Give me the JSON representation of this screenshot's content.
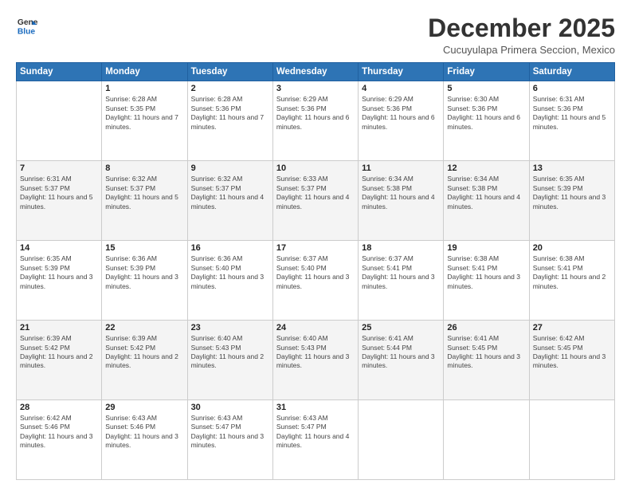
{
  "header": {
    "logo_line1": "General",
    "logo_line2": "Blue",
    "month": "December 2025",
    "location": "Cucuyulapa Primera Seccion, Mexico"
  },
  "weekdays": [
    "Sunday",
    "Monday",
    "Tuesday",
    "Wednesday",
    "Thursday",
    "Friday",
    "Saturday"
  ],
  "weeks": [
    [
      {
        "day": "",
        "sunrise": "",
        "sunset": "",
        "daylight": ""
      },
      {
        "day": "1",
        "sunrise": "Sunrise: 6:28 AM",
        "sunset": "Sunset: 5:35 PM",
        "daylight": "Daylight: 11 hours and 7 minutes."
      },
      {
        "day": "2",
        "sunrise": "Sunrise: 6:28 AM",
        "sunset": "Sunset: 5:36 PM",
        "daylight": "Daylight: 11 hours and 7 minutes."
      },
      {
        "day": "3",
        "sunrise": "Sunrise: 6:29 AM",
        "sunset": "Sunset: 5:36 PM",
        "daylight": "Daylight: 11 hours and 6 minutes."
      },
      {
        "day": "4",
        "sunrise": "Sunrise: 6:29 AM",
        "sunset": "Sunset: 5:36 PM",
        "daylight": "Daylight: 11 hours and 6 minutes."
      },
      {
        "day": "5",
        "sunrise": "Sunrise: 6:30 AM",
        "sunset": "Sunset: 5:36 PM",
        "daylight": "Daylight: 11 hours and 6 minutes."
      },
      {
        "day": "6",
        "sunrise": "Sunrise: 6:31 AM",
        "sunset": "Sunset: 5:36 PM",
        "daylight": "Daylight: 11 hours and 5 minutes."
      }
    ],
    [
      {
        "day": "7",
        "sunrise": "Sunrise: 6:31 AM",
        "sunset": "Sunset: 5:37 PM",
        "daylight": "Daylight: 11 hours and 5 minutes."
      },
      {
        "day": "8",
        "sunrise": "Sunrise: 6:32 AM",
        "sunset": "Sunset: 5:37 PM",
        "daylight": "Daylight: 11 hours and 5 minutes."
      },
      {
        "day": "9",
        "sunrise": "Sunrise: 6:32 AM",
        "sunset": "Sunset: 5:37 PM",
        "daylight": "Daylight: 11 hours and 4 minutes."
      },
      {
        "day": "10",
        "sunrise": "Sunrise: 6:33 AM",
        "sunset": "Sunset: 5:37 PM",
        "daylight": "Daylight: 11 hours and 4 minutes."
      },
      {
        "day": "11",
        "sunrise": "Sunrise: 6:34 AM",
        "sunset": "Sunset: 5:38 PM",
        "daylight": "Daylight: 11 hours and 4 minutes."
      },
      {
        "day": "12",
        "sunrise": "Sunrise: 6:34 AM",
        "sunset": "Sunset: 5:38 PM",
        "daylight": "Daylight: 11 hours and 4 minutes."
      },
      {
        "day": "13",
        "sunrise": "Sunrise: 6:35 AM",
        "sunset": "Sunset: 5:39 PM",
        "daylight": "Daylight: 11 hours and 3 minutes."
      }
    ],
    [
      {
        "day": "14",
        "sunrise": "Sunrise: 6:35 AM",
        "sunset": "Sunset: 5:39 PM",
        "daylight": "Daylight: 11 hours and 3 minutes."
      },
      {
        "day": "15",
        "sunrise": "Sunrise: 6:36 AM",
        "sunset": "Sunset: 5:39 PM",
        "daylight": "Daylight: 11 hours and 3 minutes."
      },
      {
        "day": "16",
        "sunrise": "Sunrise: 6:36 AM",
        "sunset": "Sunset: 5:40 PM",
        "daylight": "Daylight: 11 hours and 3 minutes."
      },
      {
        "day": "17",
        "sunrise": "Sunrise: 6:37 AM",
        "sunset": "Sunset: 5:40 PM",
        "daylight": "Daylight: 11 hours and 3 minutes."
      },
      {
        "day": "18",
        "sunrise": "Sunrise: 6:37 AM",
        "sunset": "Sunset: 5:41 PM",
        "daylight": "Daylight: 11 hours and 3 minutes."
      },
      {
        "day": "19",
        "sunrise": "Sunrise: 6:38 AM",
        "sunset": "Sunset: 5:41 PM",
        "daylight": "Daylight: 11 hours and 3 minutes."
      },
      {
        "day": "20",
        "sunrise": "Sunrise: 6:38 AM",
        "sunset": "Sunset: 5:41 PM",
        "daylight": "Daylight: 11 hours and 2 minutes."
      }
    ],
    [
      {
        "day": "21",
        "sunrise": "Sunrise: 6:39 AM",
        "sunset": "Sunset: 5:42 PM",
        "daylight": "Daylight: 11 hours and 2 minutes."
      },
      {
        "day": "22",
        "sunrise": "Sunrise: 6:39 AM",
        "sunset": "Sunset: 5:42 PM",
        "daylight": "Daylight: 11 hours and 2 minutes."
      },
      {
        "day": "23",
        "sunrise": "Sunrise: 6:40 AM",
        "sunset": "Sunset: 5:43 PM",
        "daylight": "Daylight: 11 hours and 2 minutes."
      },
      {
        "day": "24",
        "sunrise": "Sunrise: 6:40 AM",
        "sunset": "Sunset: 5:43 PM",
        "daylight": "Daylight: 11 hours and 3 minutes."
      },
      {
        "day": "25",
        "sunrise": "Sunrise: 6:41 AM",
        "sunset": "Sunset: 5:44 PM",
        "daylight": "Daylight: 11 hours and 3 minutes."
      },
      {
        "day": "26",
        "sunrise": "Sunrise: 6:41 AM",
        "sunset": "Sunset: 5:45 PM",
        "daylight": "Daylight: 11 hours and 3 minutes."
      },
      {
        "day": "27",
        "sunrise": "Sunrise: 6:42 AM",
        "sunset": "Sunset: 5:45 PM",
        "daylight": "Daylight: 11 hours and 3 minutes."
      }
    ],
    [
      {
        "day": "28",
        "sunrise": "Sunrise: 6:42 AM",
        "sunset": "Sunset: 5:46 PM",
        "daylight": "Daylight: 11 hours and 3 minutes."
      },
      {
        "day": "29",
        "sunrise": "Sunrise: 6:43 AM",
        "sunset": "Sunset: 5:46 PM",
        "daylight": "Daylight: 11 hours and 3 minutes."
      },
      {
        "day": "30",
        "sunrise": "Sunrise: 6:43 AM",
        "sunset": "Sunset: 5:47 PM",
        "daylight": "Daylight: 11 hours and 3 minutes."
      },
      {
        "day": "31",
        "sunrise": "Sunrise: 6:43 AM",
        "sunset": "Sunset: 5:47 PM",
        "daylight": "Daylight: 11 hours and 4 minutes."
      },
      {
        "day": "",
        "sunrise": "",
        "sunset": "",
        "daylight": ""
      },
      {
        "day": "",
        "sunrise": "",
        "sunset": "",
        "daylight": ""
      },
      {
        "day": "",
        "sunrise": "",
        "sunset": "",
        "daylight": ""
      }
    ]
  ]
}
